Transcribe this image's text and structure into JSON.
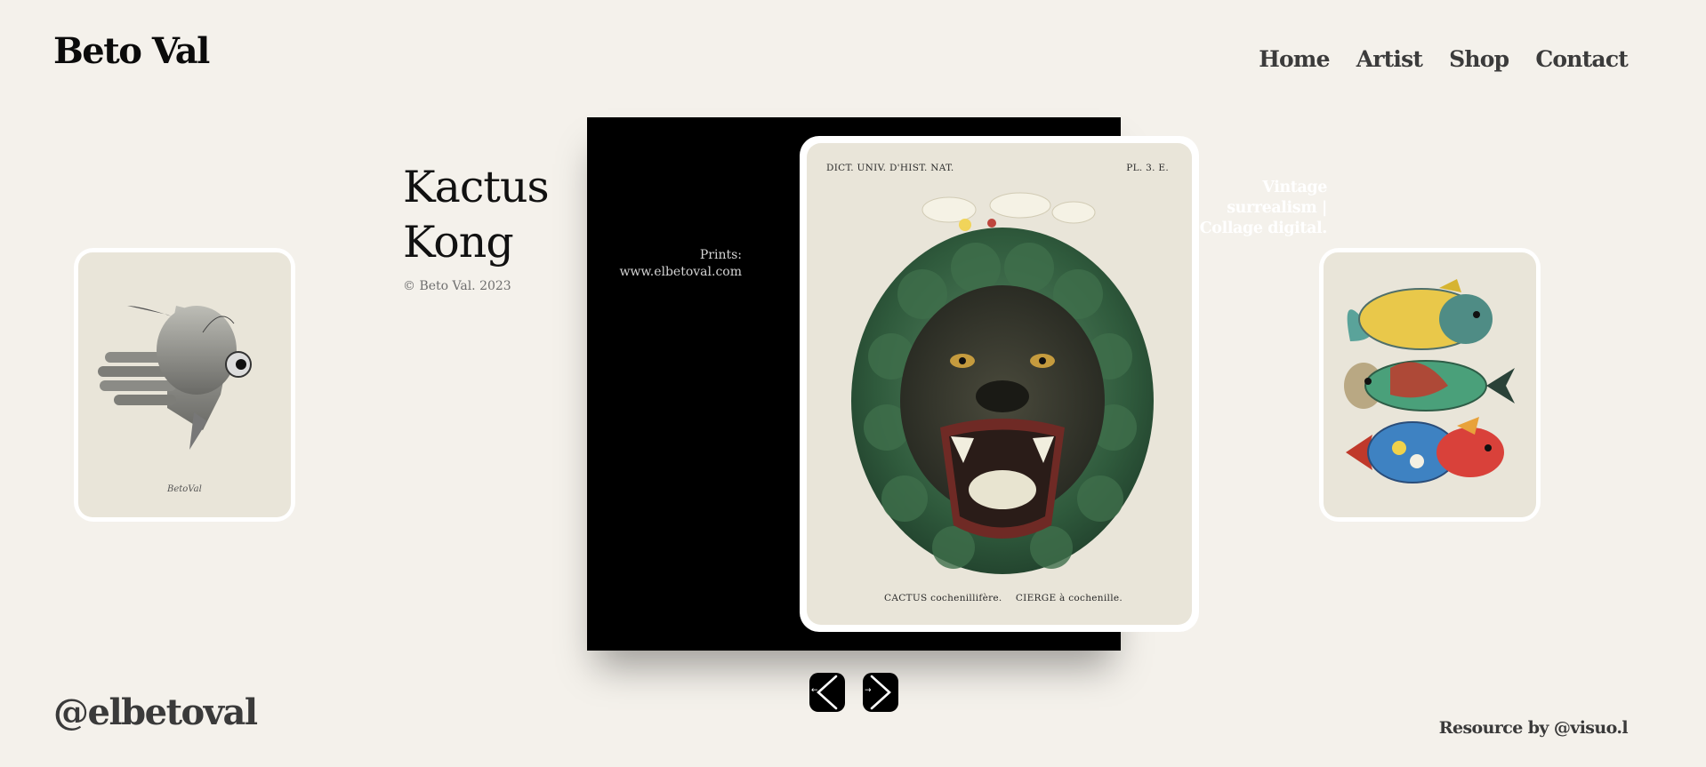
{
  "brand": {
    "name": "Beto Val"
  },
  "nav": {
    "items": [
      {
        "label": "Home"
      },
      {
        "label": "Artist"
      },
      {
        "label": "Shop"
      },
      {
        "label": "Contact"
      }
    ]
  },
  "slide": {
    "title_line1": "Kactus",
    "title_line2": "Kong",
    "copyright": "© Beto Val. 2023",
    "description": "Vintage surrealism | Collage digital.",
    "prints_label": "Prints:",
    "prints_url": "www.elbetoval.com"
  },
  "main_artwork": {
    "header_left": "DICT. UNIV. D'HIST. NAT.",
    "header_right": "PL. 3. E.",
    "footer_left": "CACTUS cochenillifère.",
    "footer_right": "CIERGE à cochenille."
  },
  "left_artwork": {
    "signature": "BetoVal"
  },
  "controls": {
    "prev_symbol": "←",
    "next_symbol": "→"
  },
  "footer": {
    "handle": "@elbetoval",
    "resource": "Resource by @visuo.l"
  },
  "colors": {
    "background": "#f4f1eb",
    "panel": "#000000",
    "text": "#111111",
    "muted": "#6e6e6e"
  }
}
